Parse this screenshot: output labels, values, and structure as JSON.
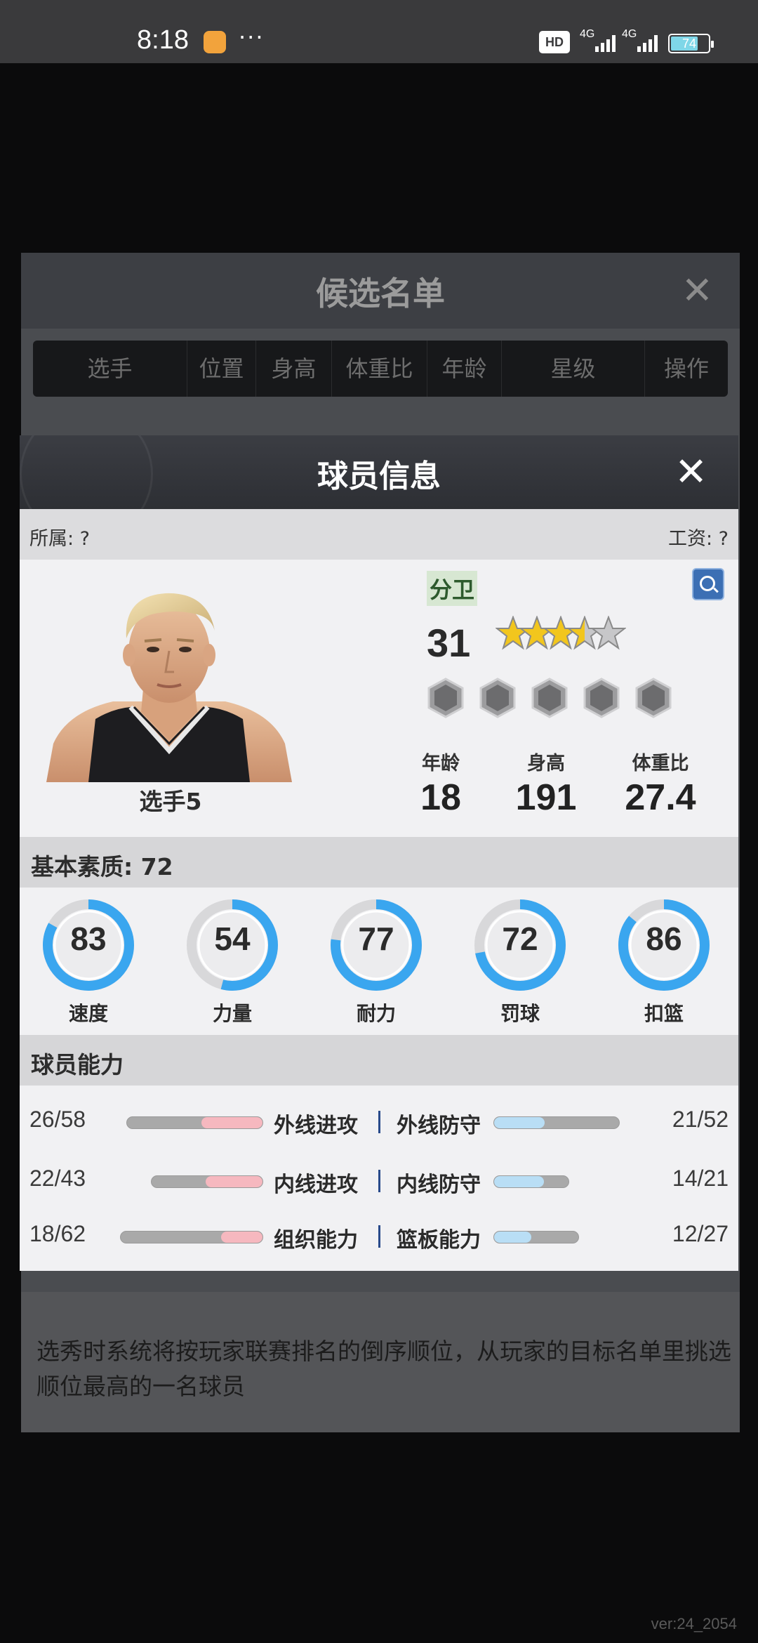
{
  "status_bar": {
    "time": "8:18",
    "more": "···",
    "hd_label": "HD",
    "net1": "4G",
    "net2": "4G",
    "battery": "74",
    "battery_level": 0.74
  },
  "background_dialog": {
    "title": "候选名单",
    "columns": [
      "选手",
      "位置",
      "身高",
      "体重比",
      "年龄",
      "星级",
      "操作"
    ],
    "footer_text": "选秀时系统将按玩家联赛排名的倒序顺位，从玩家的目标名单里挑选顺位最高的一名球员"
  },
  "modal": {
    "title": "球员信息",
    "close": "✕",
    "affiliation": "所属: ?",
    "salary": "工资: ?",
    "player": {
      "name": "选手5",
      "position": "分卫",
      "rating": "31",
      "stars": 3.5,
      "stars_max": 5,
      "bio": [
        {
          "label": "年龄",
          "value": "18"
        },
        {
          "label": "身高",
          "value": "191"
        },
        {
          "label": "体重比",
          "value": "27.4"
        }
      ]
    },
    "basic_title": "基本素质: 72",
    "attributes": [
      {
        "label": "速度",
        "value": 83
      },
      {
        "label": "力量",
        "value": 54
      },
      {
        "label": "耐力",
        "value": 77
      },
      {
        "label": "罚球",
        "value": 72
      },
      {
        "label": "扣篮",
        "value": 86
      }
    ],
    "ability_title": "球员能力",
    "abilities": [
      {
        "left_name": "外线进攻",
        "left_value": "26/58",
        "left_current": 26,
        "left_max": 58,
        "right_name": "外线防守",
        "right_value": "21/52",
        "right_current": 21,
        "right_max": 52
      },
      {
        "left_name": "内线进攻",
        "left_value": "22/43",
        "left_current": 22,
        "left_max": 43,
        "right_name": "内线防守",
        "right_value": "14/21",
        "right_current": 14,
        "right_max": 21
      },
      {
        "left_name": "组织能力",
        "left_value": "18/62",
        "left_current": 18,
        "left_max": 62,
        "right_name": "篮板能力",
        "right_value": "12/27",
        "right_current": 12,
        "right_max": 27
      }
    ]
  },
  "version": "ver:24_2054",
  "colors": {
    "gauge_fill": "#3aa6ef",
    "bar_left": "#f6b8bf",
    "bar_right": "#b9def5",
    "star": "#f2c61d"
  },
  "icons": [
    "close-icon",
    "search-icon",
    "star-icon",
    "gem-icon"
  ]
}
